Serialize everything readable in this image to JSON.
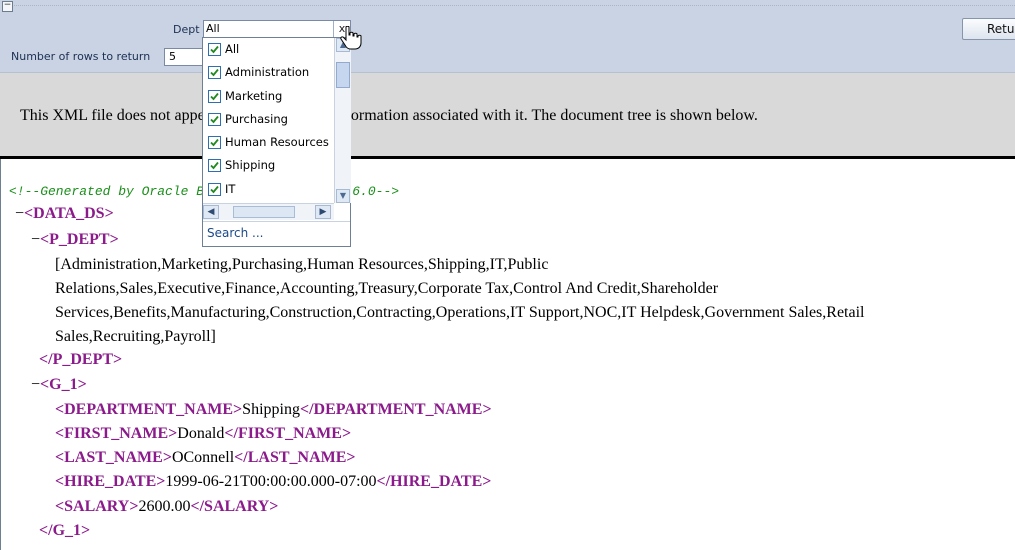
{
  "params": {
    "dept_label": "Dept",
    "dept_value": "All",
    "dept_clear_glyph": "x",
    "rows_label": "Number of rows to return",
    "rows_value": "5",
    "return_label": "Return"
  },
  "info_text": "This XML file does not appear to have any style information associated with it. The document tree is shown below.",
  "dropdown": {
    "items": [
      {
        "label": "All",
        "checked": true
      },
      {
        "label": "Administration",
        "checked": true
      },
      {
        "label": "Marketing",
        "checked": true
      },
      {
        "label": "Purchasing",
        "checked": true
      },
      {
        "label": "Human Resources",
        "checked": true
      },
      {
        "label": "Shipping",
        "checked": true
      },
      {
        "label": "IT",
        "checked": true
      }
    ],
    "search_label": "Search ..."
  },
  "xml": {
    "comment": "<!--Generated by Oracle BI Publisher 11.1.1.6.0-->",
    "collapse_glyph": "−",
    "root_tag": "DATA_DS",
    "p_dept_tag": "P_DEPT",
    "p_dept_lines": [
      "[Administration,Marketing,Purchasing,Human Resources,Shipping,IT,Public",
      "Relations,Sales,Executive,Finance,Accounting,Treasury,Corporate Tax,Control And Credit,Shareholder",
      "Services,Benefits,Manufacturing,Construction,Contracting,Operations,IT Support,NOC,IT Helpdesk,Government Sales,Retail",
      "Sales,Recruiting,Payroll]"
    ],
    "g1_tag": "G_1",
    "fields": [
      {
        "tag": "DEPARTMENT_NAME",
        "value": "Shipping"
      },
      {
        "tag": "FIRST_NAME",
        "value": "Donald"
      },
      {
        "tag": "LAST_NAME",
        "value": "OConnell"
      },
      {
        "tag": "HIRE_DATE",
        "value": "1999-06-21T00:00:00.000-07:00"
      },
      {
        "tag": "SALARY",
        "value": "2600.00"
      }
    ]
  },
  "colors": {
    "tag": "#8b1a8b",
    "comment": "#1a8f1a",
    "toolbar": "#c9d3e3",
    "info_band": "#d9d9d9"
  }
}
